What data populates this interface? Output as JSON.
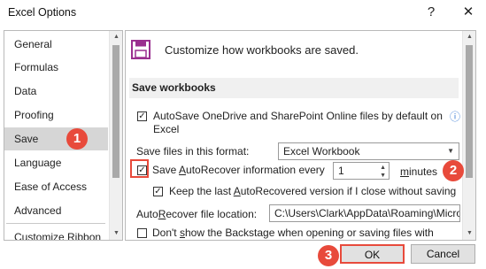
{
  "window": {
    "title": "Excel Options",
    "help_label": "?",
    "close_label": "✕"
  },
  "sidebar": {
    "items": [
      {
        "label": "General"
      },
      {
        "label": "Formulas"
      },
      {
        "label": "Data"
      },
      {
        "label": "Proofing"
      },
      {
        "label": "Save",
        "selected": true
      },
      {
        "label": "Language"
      },
      {
        "label": "Ease of Access"
      },
      {
        "label": "Advanced"
      },
      {
        "label": "Customize Ribbon"
      }
    ]
  },
  "main": {
    "header": "Customize how workbooks are saved.",
    "section_title": "Save workbooks",
    "autosave_label": "AutoSave OneDrive and SharePoint Online files by default on",
    "autosave_label_line2": "Excel",
    "autosave_checked": true,
    "info_icon": "ⓘ",
    "format_label": "Save files in this format:",
    "format_value": "Excel Workbook",
    "autorecover_label_pre": "Save ",
    "autorecover_label_key": "A",
    "autorecover_label_post": "utoRecover information every",
    "autorecover_checked": true,
    "autorecover_minutes": "1",
    "minutes_key": "m",
    "minutes_rest": "inutes",
    "keep_label_pre": "Keep the last ",
    "keep_label_key": "A",
    "keep_label_post": "utoRecovered version if I close without saving",
    "keep_checked": true,
    "location_label_pre": "Auto",
    "location_label_key": "R",
    "location_label_post": "ecover file location:",
    "location_value": "C:\\Users\\Clark\\AppData\\Roaming\\Micro",
    "backstage_label_pre": "Don't ",
    "backstage_label_key": "s",
    "backstage_label_post": "how the Backstage when opening or saving files with",
    "backstage_checked": false
  },
  "footer": {
    "ok_label": "OK",
    "cancel_label": "Cancel"
  },
  "annotations": {
    "step1": "1",
    "step2": "2",
    "step3": "3"
  },
  "colors": {
    "accent": "#e84a3b",
    "icon_purple": "#9a2f8f",
    "selected_bg": "#d6d6d6"
  }
}
